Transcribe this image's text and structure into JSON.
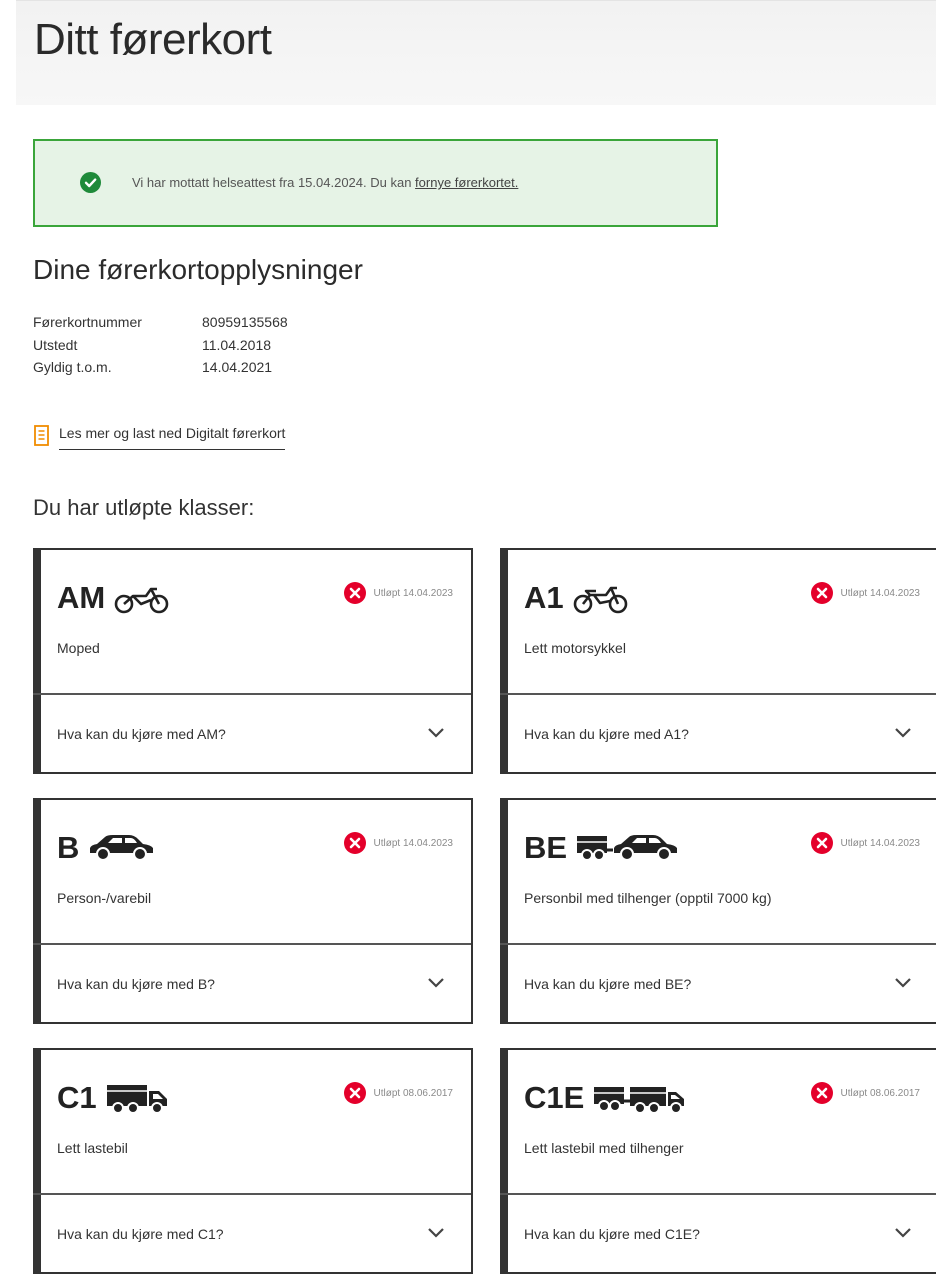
{
  "header": {
    "title": "Ditt førerkort"
  },
  "alert": {
    "message": "Vi har mottatt helseattest fra 15.04.2024. Du kan ",
    "link": "fornye førerkortet."
  },
  "section_title": "Dine førerkortopplysninger",
  "info": [
    {
      "label": "Førerkortnummer",
      "value": "80959135568"
    },
    {
      "label": "Utstedt",
      "value": "11.04.2018"
    },
    {
      "label": "Gyldig t.o.m.",
      "value": "14.04.2021"
    }
  ],
  "download_link": "Les mer og last ned Digitalt førerkort",
  "expired_title": "Du har utløpte klasser:",
  "cards": [
    {
      "code": "AM",
      "icon": "moped-icon",
      "status": "Utløpt 14.04.2023",
      "desc": "Moped",
      "question": "Hva kan du kjøre med AM?"
    },
    {
      "code": "A1",
      "icon": "motorcycle-icon",
      "status": "Utløpt 14.04.2023",
      "desc": "Lett motorsykkel",
      "question": "Hva kan du kjøre med A1?"
    },
    {
      "code": "B",
      "icon": "car-icon",
      "status": "Utløpt 14.04.2023",
      "desc": "Person-/varebil",
      "question": "Hva kan du kjøre med B?"
    },
    {
      "code": "BE",
      "icon": "car-trailer-icon",
      "status": "Utløpt 14.04.2023",
      "desc": "Personbil med tilhenger (opptil 7000 kg)",
      "question": "Hva kan du kjøre med BE?"
    },
    {
      "code": "C1",
      "icon": "truck-icon",
      "status": "Utløpt 08.06.2017",
      "desc": "Lett lastebil",
      "question": "Hva kan du kjøre med C1?"
    },
    {
      "code": "C1E",
      "icon": "truck-trailer-icon",
      "status": "Utløpt 08.06.2017",
      "desc": "Lett lastebil med tilhenger",
      "question": "Hva kan du kjøre med C1E?"
    }
  ],
  "colors": {
    "success_border": "#3aa53a",
    "success_bg": "#e6f3e6",
    "error": "#e4002b",
    "download_icon": "#f08c00"
  }
}
